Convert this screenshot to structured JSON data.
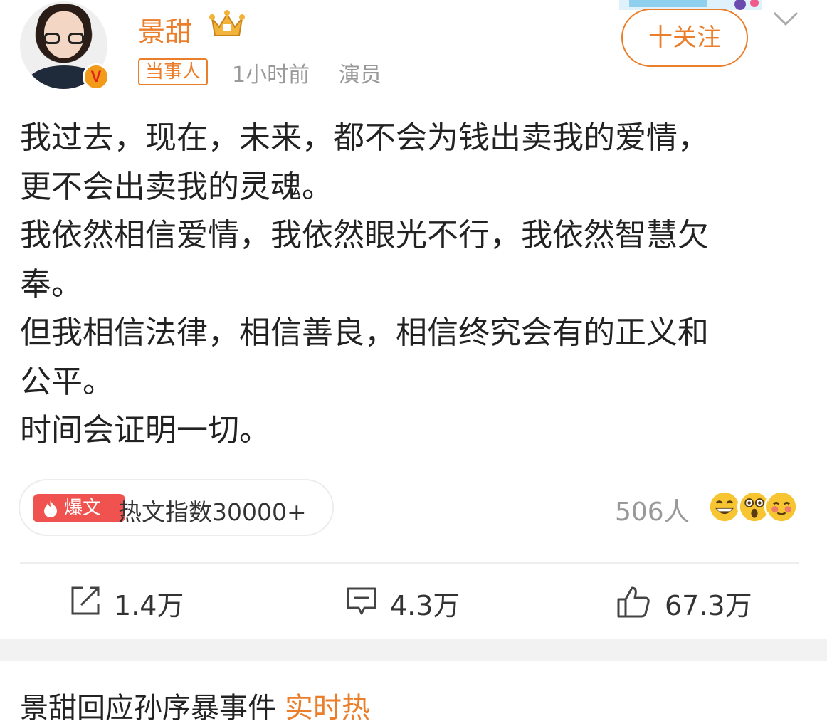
{
  "post": {
    "author": {
      "name": "景甜",
      "tag": "当事人",
      "time": "1小时前",
      "occupation": "演员"
    },
    "follow_label": "十关注",
    "paragraphs": [
      "我过去，现在，未来，都不会为钱出卖我的爱情，",
      "更不会出卖我的灵魂。",
      "我依然相信爱情，我依然眼光不行，我依然智慧欠",
      "奉。",
      "但我相信法律，相信善良，相信终究会有的正义和",
      "公平。",
      "时间会证明一切。"
    ],
    "hot": {
      "badge": "爆文",
      "text": "热文指数30000+"
    },
    "reactions": {
      "count": "506人",
      "icons": [
        "grin-emoji-icon",
        "surprised-emoji-icon",
        "blush-emoji-icon"
      ]
    },
    "actions": {
      "repost": "1.4万",
      "comment": "4.3万",
      "like": "67.3万"
    }
  },
  "next_post": {
    "title": "景甜回应孙序暴事件",
    "trail": "实时热"
  },
  "colors": {
    "accent": "#eb7e2a",
    "hot_badge": "#f0534f",
    "muted": "#999999"
  }
}
